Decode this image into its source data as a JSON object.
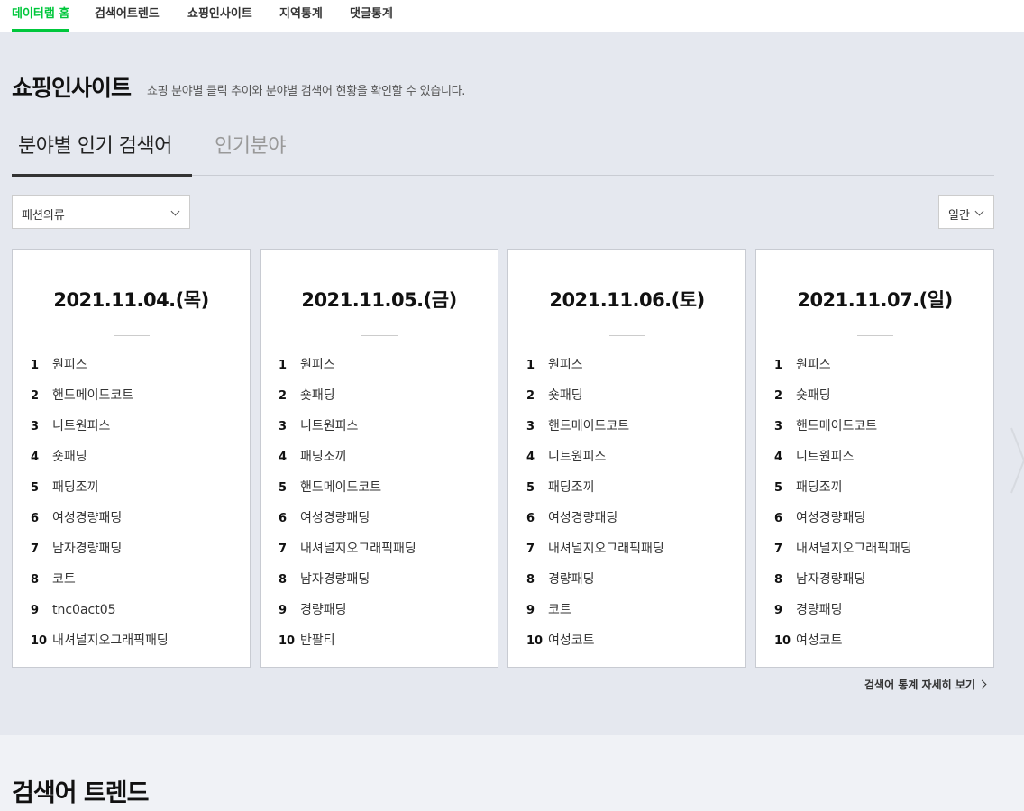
{
  "topnav": {
    "items": [
      {
        "label": "데이터랩 홈",
        "active": true
      },
      {
        "label": "검색어트렌드",
        "active": false
      },
      {
        "label": "쇼핑인사이트",
        "active": false
      },
      {
        "label": "지역통계",
        "active": false
      },
      {
        "label": "댓글통계",
        "active": false
      }
    ]
  },
  "page": {
    "title": "쇼핑인사이트",
    "description": "쇼핑 분야별 클릭 추이와 분야별 검색어 현황을 확인할 수 있습니다."
  },
  "tabs": [
    {
      "label": "분야별 인기 검색어",
      "active": true
    },
    {
      "label": "인기분야",
      "active": false
    }
  ],
  "filters": {
    "category": "패션의류",
    "period": "일간"
  },
  "cards": [
    {
      "date": "2021.11.04.(목)",
      "items": [
        {
          "rank": "1",
          "keyword": "원피스"
        },
        {
          "rank": "2",
          "keyword": "핸드메이드코트"
        },
        {
          "rank": "3",
          "keyword": "니트원피스"
        },
        {
          "rank": "4",
          "keyword": "숏패딩"
        },
        {
          "rank": "5",
          "keyword": "패딩조끼"
        },
        {
          "rank": "6",
          "keyword": "여성경량패딩"
        },
        {
          "rank": "7",
          "keyword": "남자경량패딩"
        },
        {
          "rank": "8",
          "keyword": "코트"
        },
        {
          "rank": "9",
          "keyword": "tnc0act05"
        },
        {
          "rank": "10",
          "keyword": "내셔널지오그래픽패딩"
        }
      ]
    },
    {
      "date": "2021.11.05.(금)",
      "items": [
        {
          "rank": "1",
          "keyword": "원피스"
        },
        {
          "rank": "2",
          "keyword": "숏패딩"
        },
        {
          "rank": "3",
          "keyword": "니트원피스"
        },
        {
          "rank": "4",
          "keyword": "패딩조끼"
        },
        {
          "rank": "5",
          "keyword": "핸드메이드코트"
        },
        {
          "rank": "6",
          "keyword": "여성경량패딩"
        },
        {
          "rank": "7",
          "keyword": "내셔널지오그래픽패딩"
        },
        {
          "rank": "8",
          "keyword": "남자경량패딩"
        },
        {
          "rank": "9",
          "keyword": "경량패딩"
        },
        {
          "rank": "10",
          "keyword": "반팔티"
        }
      ]
    },
    {
      "date": "2021.11.06.(토)",
      "items": [
        {
          "rank": "1",
          "keyword": "원피스"
        },
        {
          "rank": "2",
          "keyword": "숏패딩"
        },
        {
          "rank": "3",
          "keyword": "핸드메이드코트"
        },
        {
          "rank": "4",
          "keyword": "니트원피스"
        },
        {
          "rank": "5",
          "keyword": "패딩조끼"
        },
        {
          "rank": "6",
          "keyword": "여성경량패딩"
        },
        {
          "rank": "7",
          "keyword": "내셔널지오그래픽패딩"
        },
        {
          "rank": "8",
          "keyword": "경량패딩"
        },
        {
          "rank": "9",
          "keyword": "코트"
        },
        {
          "rank": "10",
          "keyword": "여성코트"
        }
      ]
    },
    {
      "date": "2021.11.07.(일)",
      "items": [
        {
          "rank": "1",
          "keyword": "원피스"
        },
        {
          "rank": "2",
          "keyword": "숏패딩"
        },
        {
          "rank": "3",
          "keyword": "핸드메이드코트"
        },
        {
          "rank": "4",
          "keyword": "니트원피스"
        },
        {
          "rank": "5",
          "keyword": "패딩조끼"
        },
        {
          "rank": "6",
          "keyword": "여성경량패딩"
        },
        {
          "rank": "7",
          "keyword": "내셔널지오그래픽패딩"
        },
        {
          "rank": "8",
          "keyword": "남자경량패딩"
        },
        {
          "rank": "9",
          "keyword": "경량패딩"
        },
        {
          "rank": "10",
          "keyword": "여성코트"
        }
      ]
    }
  ],
  "more_link": "검색어 통계 자세히 보기",
  "section2": {
    "title": "검색어 트렌드"
  },
  "colors": {
    "accent": "#00c73c",
    "background": "#e5e8ef"
  }
}
